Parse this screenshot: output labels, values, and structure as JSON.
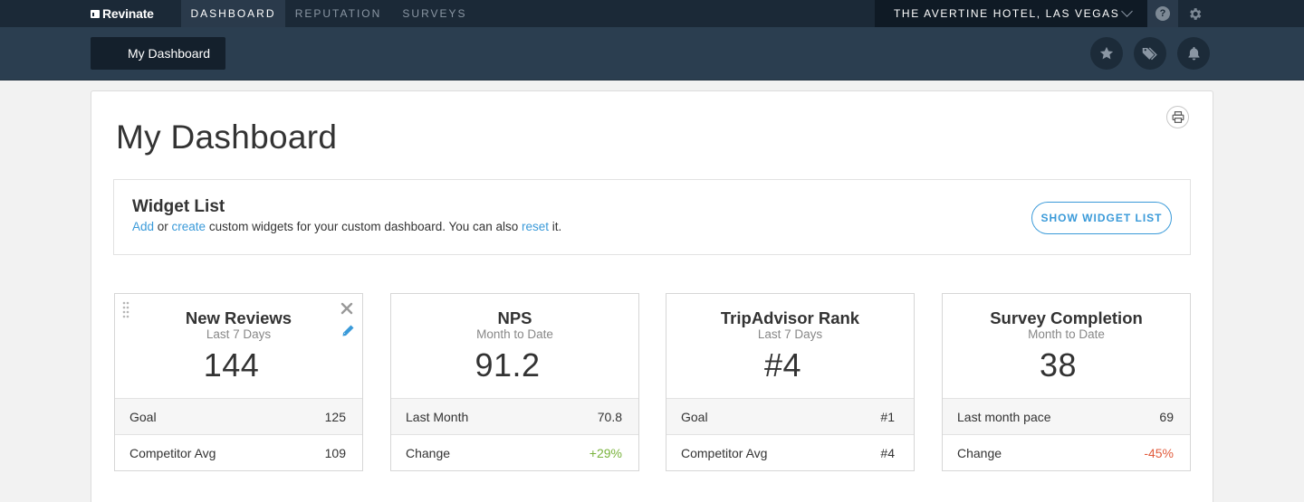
{
  "topbar": {
    "logo": "Revinate",
    "tabs": [
      "DASHBOARD",
      "REPUTATION",
      "SURVEYS"
    ],
    "hotel": "THE AVERTINE HOTEL, LAS VEGAS",
    "help_glyph": "?"
  },
  "subbar": {
    "dashboard_button": "My Dashboard"
  },
  "page": {
    "title": "My Dashboard"
  },
  "widget_list": {
    "title": "Widget List",
    "add_link": "Add",
    "or_text": " or ",
    "create_link": "create",
    "middle_text": " custom widgets for your custom dashboard. You can also ",
    "reset_link": "reset",
    "end_text": " it.",
    "button": "SHOW WIDGET LIST"
  },
  "widgets": [
    {
      "title": "New Reviews",
      "period": "Last 7 Days",
      "value": "144",
      "rows": [
        {
          "label": "Goal",
          "value": "125"
        },
        {
          "label": "Competitor Avg",
          "value": "109"
        }
      ]
    },
    {
      "title": "NPS",
      "period": "Month to Date",
      "value": "91.2",
      "rows": [
        {
          "label": "Last Month",
          "value": "70.8"
        },
        {
          "label": "Change",
          "value": "+29%"
        }
      ]
    },
    {
      "title": "TripAdvisor Rank",
      "period": "Last 7 Days",
      "value": "#4",
      "rows": [
        {
          "label": "Goal",
          "value": "#1"
        },
        {
          "label": "Competitor Avg",
          "value": "#4"
        }
      ]
    },
    {
      "title": "Survey Completion",
      "period": "Month to Date",
      "value": "38",
      "rows": [
        {
          "label": "Last month pace",
          "value": "69"
        },
        {
          "label": "Change",
          "value": "-45%"
        }
      ]
    }
  ],
  "colors": {
    "topbar": "#1b2937",
    "subbar": "#2b3e50",
    "link": "#3a9ad9",
    "positive": "#7ab33e",
    "negative": "#e15b3c"
  }
}
